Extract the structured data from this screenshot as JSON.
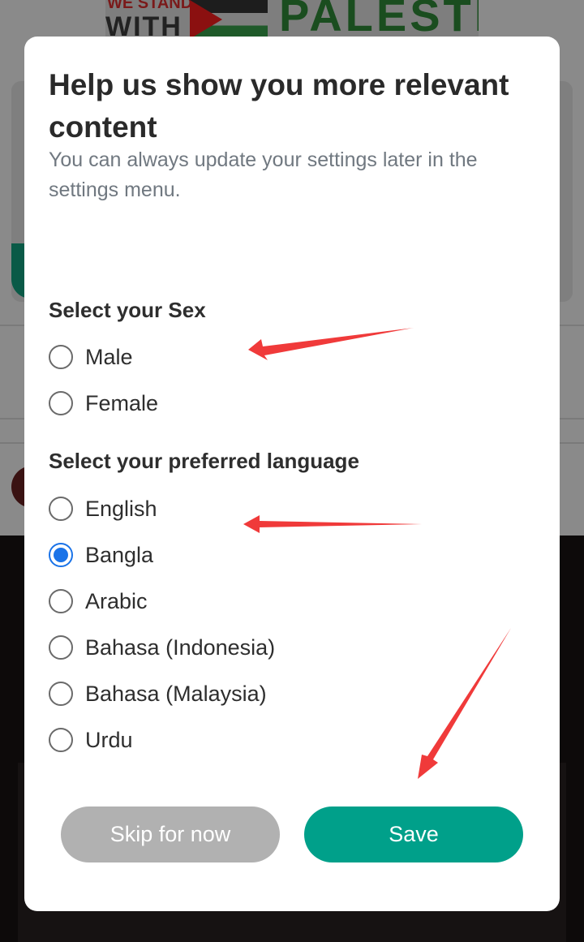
{
  "background": {
    "banner_text_top": "WE STAND",
    "banner_text_with": "WITH",
    "banner_text_country": "PALESTINE"
  },
  "modal": {
    "title": "Help us show you more relevant content",
    "subtitle": "You can always update your settings later in the settings menu.",
    "sex_section": {
      "label": "Select your Sex",
      "options": [
        {
          "label": "Male",
          "checked": false
        },
        {
          "label": "Female",
          "checked": false
        }
      ]
    },
    "language_section": {
      "label": "Select your preferred language",
      "options": [
        {
          "label": "English",
          "checked": false
        },
        {
          "label": "Bangla",
          "checked": true
        },
        {
          "label": "Arabic",
          "checked": false
        },
        {
          "label": "Bahasa (Indonesia)",
          "checked": false
        },
        {
          "label": "Bahasa (Malaysia)",
          "checked": false
        },
        {
          "label": "Urdu",
          "checked": false
        }
      ]
    },
    "buttons": {
      "skip_label": "Skip for now",
      "save_label": "Save"
    }
  },
  "colors": {
    "accent": "#00a08a",
    "radio_selected": "#1a73e8",
    "skip_button": "#b1b1b1",
    "annotation_arrow": "#f03a3a"
  }
}
